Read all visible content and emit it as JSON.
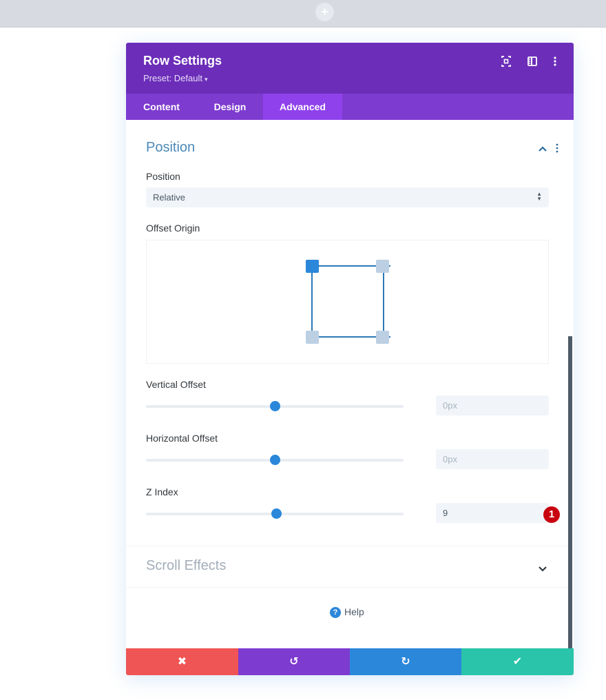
{
  "topbar": {
    "add_icon": "plus-icon",
    "add_glyph": "+"
  },
  "modal": {
    "title": "Row Settings",
    "preset": "Preset: Default",
    "preset_caret": "▾",
    "header_icons": [
      "expand-icon",
      "sidebar-layout-icon",
      "more-vertical-icon"
    ],
    "tabs": [
      {
        "label": "Content",
        "active": false
      },
      {
        "label": "Design",
        "active": false
      },
      {
        "label": "Advanced",
        "active": true
      }
    ]
  },
  "position_section": {
    "title": "Position",
    "expanded": true,
    "position_field": {
      "label": "Position",
      "value": "Relative",
      "arrow": "▲▼"
    },
    "offset_origin": {
      "label": "Offset Origin",
      "selected": "top-left",
      "handles": [
        "top-left",
        "top-right",
        "bottom-left",
        "bottom-right"
      ]
    },
    "vertical_offset": {
      "label": "Vertical Offset",
      "placeholder": "0px",
      "value": "",
      "slider_fraction": 0.5
    },
    "horizontal_offset": {
      "label": "Horizontal Offset",
      "placeholder": "0px",
      "value": "",
      "slider_fraction": 0.5
    },
    "z_index": {
      "label": "Z Index",
      "value": "9",
      "slider_fraction": 0.508,
      "badge": "1"
    }
  },
  "scroll_effects_section": {
    "title": "Scroll Effects",
    "expanded": false
  },
  "help": {
    "label": "Help",
    "icon_glyph": "?"
  },
  "footer": {
    "buttons": [
      {
        "name": "cancel",
        "glyph": "✖",
        "color": "#ef5555"
      },
      {
        "name": "undo",
        "glyph": "↺",
        "color": "#7e3bd0"
      },
      {
        "name": "redo",
        "glyph": "↻",
        "color": "#2b87da"
      },
      {
        "name": "save",
        "glyph": "✔",
        "color": "#29c4a9"
      }
    ]
  },
  "colors": {
    "header": "#6c2eb9",
    "tabs": "#7d3bcf",
    "tab_active": "#8f42ec",
    "accent_blue": "#2b87da",
    "section_title": "#4c89b8",
    "badge": "#c8000f"
  }
}
